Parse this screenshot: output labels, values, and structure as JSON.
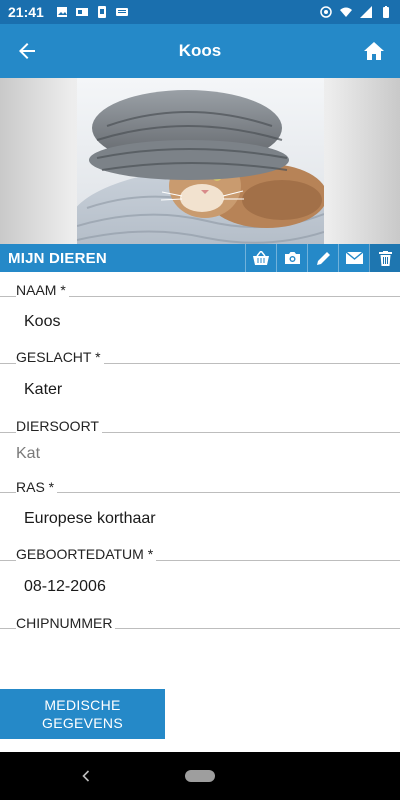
{
  "status_bar": {
    "time": "21:41"
  },
  "app_bar": {
    "title": "Koos",
    "back_icon": "arrow-left-icon",
    "home_icon": "home-icon"
  },
  "section": {
    "title": "MIJN DIEREN",
    "actions": [
      "basket-icon",
      "camera-icon",
      "pencil-icon",
      "envelope-icon",
      "trash-icon"
    ]
  },
  "fields": {
    "naam": {
      "label": "NAAM *",
      "value": "Koos"
    },
    "geslacht": {
      "label": "GESLACHT *",
      "value": "Kater"
    },
    "diersoort": {
      "label": "DIERSOORT",
      "value": "Kat"
    },
    "ras": {
      "label": "RAS *",
      "value": "Europese korthaar"
    },
    "geboortedatum": {
      "label": "GEBOORTEDATUM *",
      "value": "08-12-2006"
    },
    "chipnummer": {
      "label": "CHIPNUMMER",
      "value": ""
    }
  },
  "medical_button": {
    "line1": "MEDISCHE",
    "line2": "GEGEVENS"
  },
  "colors": {
    "primary": "#2589c8",
    "status": "#1a6fae"
  }
}
